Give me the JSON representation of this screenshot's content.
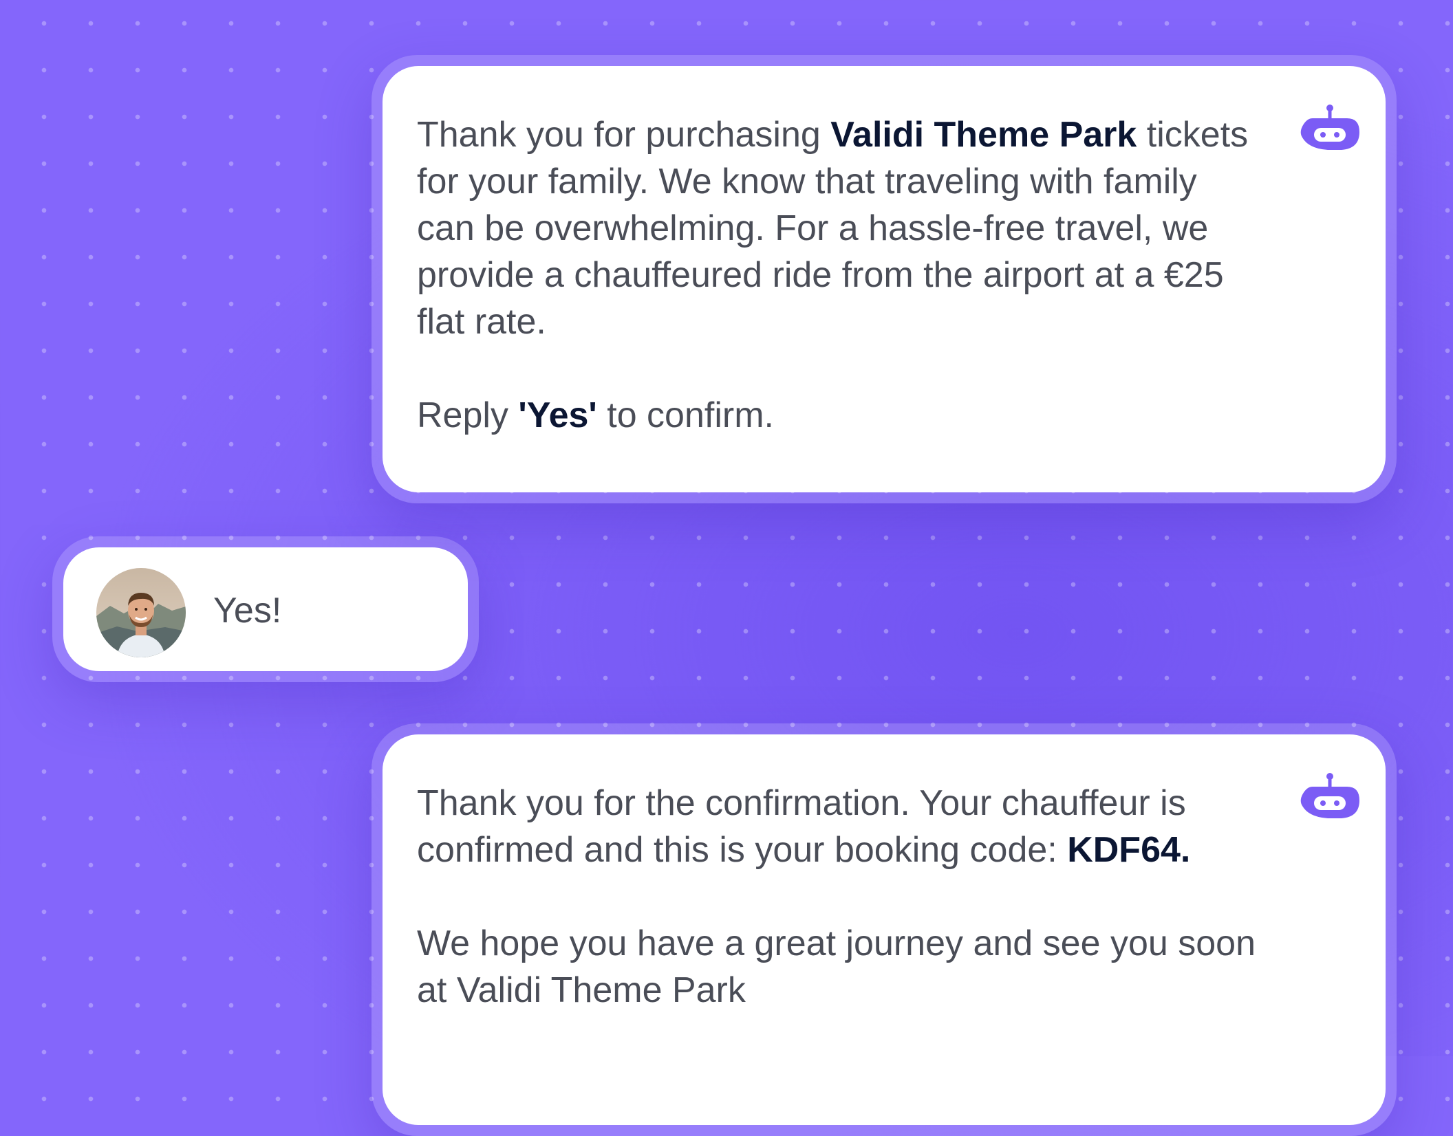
{
  "colors": {
    "background": "#8466fb",
    "bubble": "#ffffff",
    "body_text": "#4a4d57",
    "emphasis_text": "#0b1633",
    "bot_icon": "#7b5cf5"
  },
  "messages": {
    "bot1": {
      "icon": "bot-icon",
      "p1_before": "Thank you for purchasing ",
      "p1_bold": "Validi Theme Park",
      "p1_after": " tickets for your family. We know that traveling with family can be overwhelming. For a hassle-free travel, we provide a chauffeured ride from the airport at a €25 flat rate.",
      "p2_before": "Reply ",
      "p2_bold": "'Yes'",
      "p2_after": " to confirm."
    },
    "user1": {
      "avatar": "user-avatar",
      "text": "Yes!"
    },
    "bot2": {
      "icon": "bot-icon",
      "p1_before": "Thank you for the confirmation. Your chauffeur is confirmed and this is your booking code: ",
      "p1_bold": "KDF64.",
      "p2": "We hope you have a great journey and see you soon at Validi Theme Park"
    }
  }
}
